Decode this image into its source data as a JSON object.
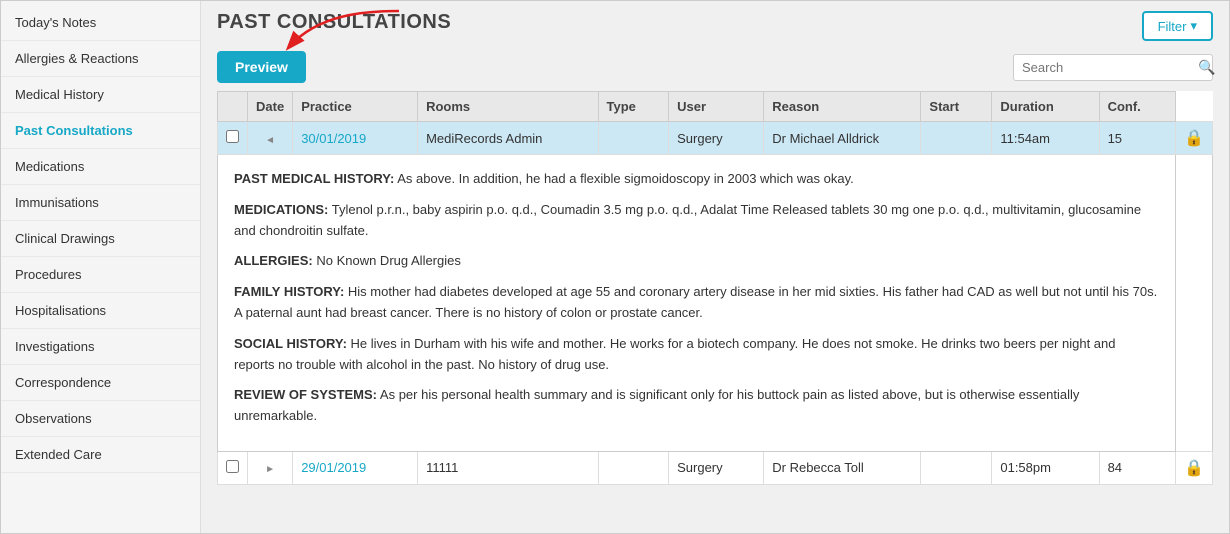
{
  "sidebar": {
    "items": [
      {
        "label": "Today's Notes",
        "active": false
      },
      {
        "label": "Allergies & Reactions",
        "active": false
      },
      {
        "label": "Medical History",
        "active": false
      },
      {
        "label": "Past Consultations",
        "active": true
      },
      {
        "label": "Medications",
        "active": false
      },
      {
        "label": "Immunisations",
        "active": false
      },
      {
        "label": "Clinical Drawings",
        "active": false
      },
      {
        "label": "Procedures",
        "active": false
      },
      {
        "label": "Hospitalisations",
        "active": false
      },
      {
        "label": "Investigations",
        "active": false
      },
      {
        "label": "Correspondence",
        "active": false
      },
      {
        "label": "Observations",
        "active": false
      },
      {
        "label": "Extended Care",
        "active": false
      }
    ]
  },
  "header": {
    "title": "PAST CONSULTATIONS",
    "filter_label": "Filter",
    "filter_icon": "▾"
  },
  "toolbar": {
    "preview_label": "Preview",
    "search_placeholder": "Search",
    "search_icon": "🔍"
  },
  "table": {
    "columns": [
      "",
      "Date",
      "Practice",
      "Rooms",
      "Type",
      "User",
      "Reason",
      "Start",
      "Duration",
      "Conf."
    ],
    "rows": [
      {
        "expanded": true,
        "highlighted": true,
        "checkbox": "",
        "expand_icon": "◄",
        "date": "30/01/2019",
        "practice": "MediRecords Admin",
        "rooms": "",
        "type": "Surgery",
        "user": "Dr Michael Alldrick",
        "reason": "",
        "start": "11:54am",
        "duration": "15",
        "conf": "🔒"
      },
      {
        "expanded": false,
        "highlighted": false,
        "checkbox": "",
        "expand_icon": "►",
        "date": "29/01/2019",
        "practice": "11111",
        "rooms": "",
        "type": "Surgery",
        "user": "Dr Rebecca Toll",
        "reason": "",
        "start": "01:58pm",
        "duration": "84",
        "conf": "🔒"
      }
    ]
  },
  "detail": {
    "sections": [
      {
        "label": "PAST MEDICAL HISTORY:",
        "text": " As above. In addition, he had a flexible sigmoidoscopy in 2003 which was okay."
      },
      {
        "label": "MEDICATIONS:",
        "text": " Tylenol p.r.n., baby aspirin p.o. q.d., Coumadin 3.5 mg p.o. q.d., Adalat Time Released tablets 30 mg one p.o. q.d., multivitamin, glucosamine and chondroitin sulfate."
      },
      {
        "label": "ALLERGIES:",
        "text": " No Known Drug Allergies"
      },
      {
        "label": "FAMILY HISTORY:",
        "text": " His mother had diabetes developed at age 55 and coronary artery disease in her mid sixties. His father had CAD as well but not until his 70s. A paternal aunt had breast cancer. There is no history of colon or prostate cancer."
      },
      {
        "label": "SOCIAL HISTORY:",
        "text": " He lives in Durham with his wife and mother. He works for a biotech company. He does not smoke. He drinks two beers per night and reports no trouble with alcohol in the past. No history of drug use."
      },
      {
        "label": "REVIEW OF SYSTEMS:",
        "text": " As per his personal health summary and is significant only for his buttock pain as listed above, but is otherwise essentially unremarkable."
      }
    ]
  },
  "colors": {
    "accent": "#17a8c7",
    "highlight_row": "#cce8f5",
    "header_bg": "#e8e8e8"
  }
}
